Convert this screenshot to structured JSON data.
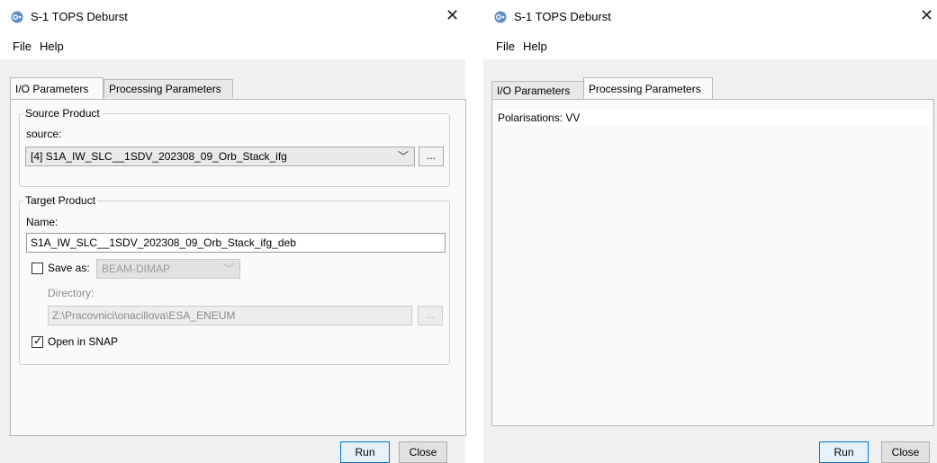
{
  "left_window": {
    "title": "S-1 TOPS Deburst",
    "menu": [
      "File",
      "Help"
    ],
    "tabs": [
      "I/O Parameters",
      "Processing Parameters"
    ],
    "source_group": {
      "title": "Source Product",
      "source_label": "source:",
      "source_value": "[4] S1A_IW_SLC__1SDV_202308_09_Orb_Stack_ifg",
      "browse": "..."
    },
    "target_group": {
      "title": "Target Product",
      "name_label": "Name:",
      "name_value": "S1A_IW_SLC__1SDV_202308_09_Orb_Stack_ifg_deb",
      "save_as_label": "Save as:",
      "save_as_checked": false,
      "format_value": "BEAM-DIMAP",
      "directory_label": "Directory:",
      "directory_value": "Z:\\Pracovnici\\onacillova\\ESA_ENEUM",
      "browse": "...",
      "open_in_snap_label": "Open in SNAP",
      "open_in_snap_checked": true
    },
    "buttons": {
      "run": "Run",
      "close": "Close"
    }
  },
  "right_window": {
    "title": "S-1 TOPS Deburst",
    "menu": [
      "File",
      "Help"
    ],
    "tabs": [
      "I/O Parameters",
      "Processing Parameters"
    ],
    "polarisations_label": "Polarisations:",
    "polarisations_value": "VV",
    "buttons": {
      "run": "Run",
      "close": "Close"
    }
  },
  "icons": {
    "app": "snap-app-icon",
    "close": "close-icon",
    "dropdown": "chevron-down-icon",
    "checkbox": "checkmark-icon"
  },
  "colors": {
    "default_button_border": "#0078d7",
    "panel_bg": "#fafafa",
    "window_bg": "#f0f0f0"
  }
}
